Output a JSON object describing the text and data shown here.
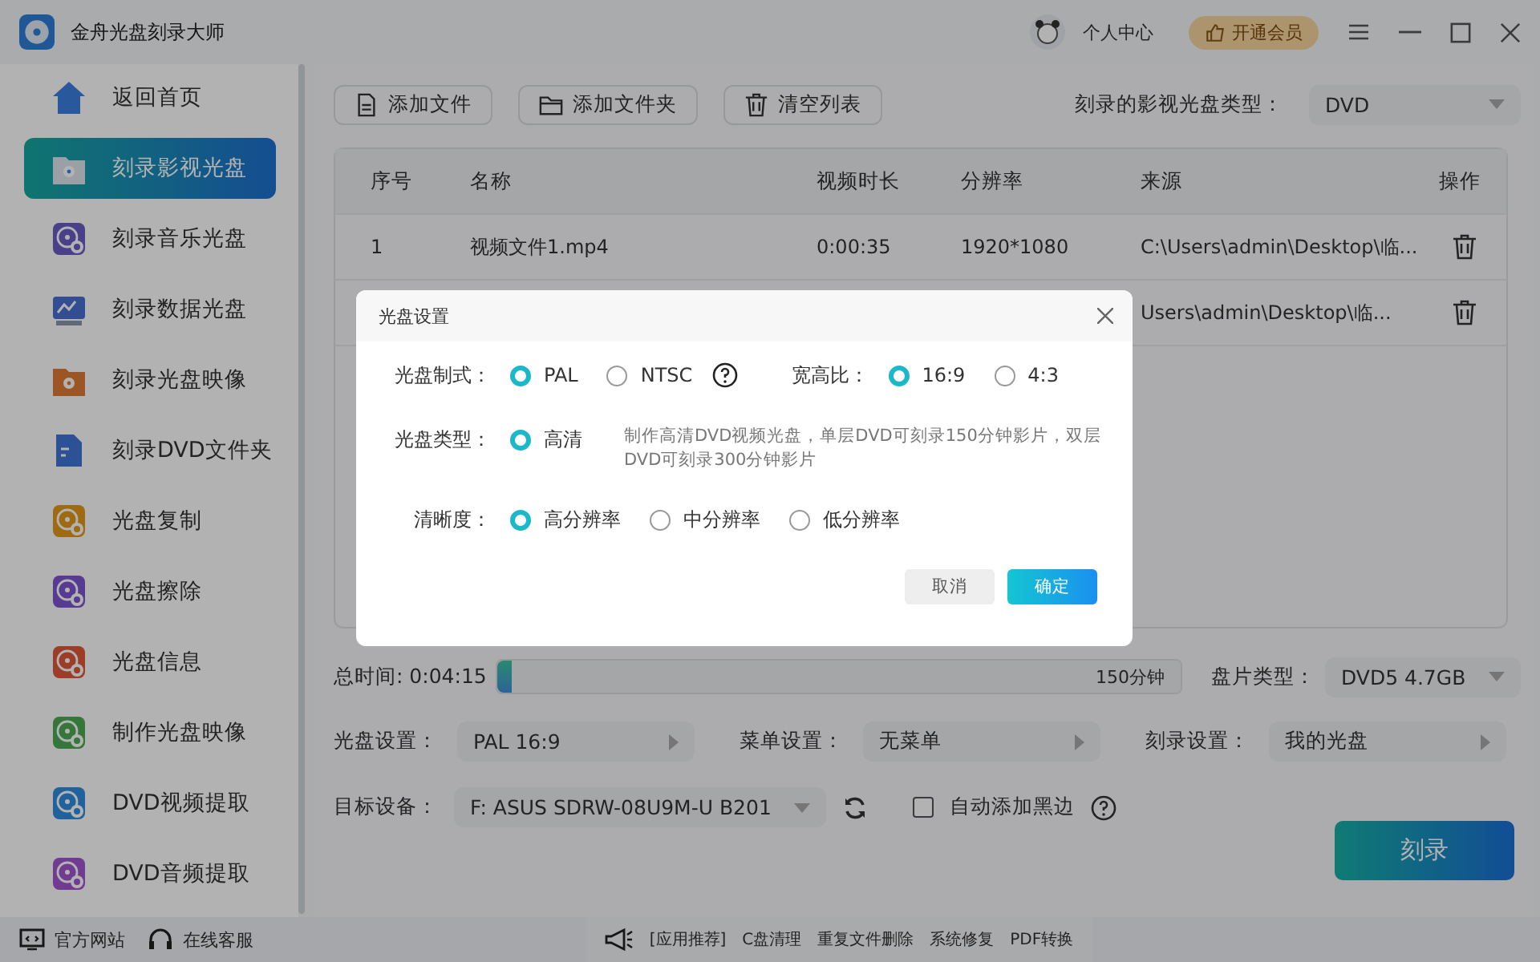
{
  "app": {
    "title": "金舟光盘刻录大师",
    "user_label": "个人中心",
    "vip_button": "开通会员"
  },
  "sidebar": {
    "items": [
      {
        "label": "返回首页",
        "kind": "home",
        "selected": false
      },
      {
        "label": "刻录影视光盘",
        "kind": "folder",
        "selected": true
      },
      {
        "label": "刻录音乐光盘",
        "kind": "disc",
        "selected": false
      },
      {
        "label": "刻录数据光盘",
        "kind": "screen",
        "selected": false
      },
      {
        "label": "刻录光盘映像",
        "kind": "folder",
        "selected": false
      },
      {
        "label": "刻录DVD文件夹",
        "kind": "doc",
        "selected": false
      },
      {
        "label": "光盘复制",
        "kind": "disc",
        "selected": false
      },
      {
        "label": "光盘擦除",
        "kind": "disc",
        "selected": false
      },
      {
        "label": "光盘信息",
        "kind": "disc",
        "selected": false
      },
      {
        "label": "制作光盘映像",
        "kind": "disc",
        "selected": false
      },
      {
        "label": "DVD视频提取",
        "kind": "disc",
        "selected": false
      },
      {
        "label": "DVD音频提取",
        "kind": "disc",
        "selected": false
      }
    ],
    "footer_links": [
      "官方网站",
      "在线客服"
    ]
  },
  "toolbar": {
    "buttons": [
      {
        "label": "添加文件",
        "kind": "file"
      },
      {
        "label": "添加文件夹",
        "kind": "folder"
      },
      {
        "label": "清空列表",
        "kind": "trash"
      }
    ],
    "disc_type_label": "刻录的影视光盘类型：",
    "disc_type_value": "DVD"
  },
  "table": {
    "columns": [
      "序号",
      "名称",
      "视频时长",
      "分辨率",
      "来源",
      "操作"
    ],
    "rows": [
      {
        "index": "1",
        "name": "视频文件1.mp4",
        "duration": "0:00:35",
        "resolution": "1920*1080",
        "source": "C:\\Users\\admin\\Desktop\\临..."
      },
      {
        "source": "Users\\admin\\Desktop\\临..."
      }
    ]
  },
  "capacity": {
    "label": "总时间: 0:04:15",
    "level": 0.02,
    "limit": "150分钟"
  },
  "disc_size": {
    "label": "盘片类型：",
    "value": "DVD5 4.7GB"
  },
  "settings": [
    {
      "label": "光盘设置：",
      "value": "PAL 16:9"
    },
    {
      "label": "菜单设置：",
      "value": "无菜单"
    },
    {
      "label": "刻录设置：",
      "value": "我的光盘"
    }
  ],
  "device": {
    "label": "目标设备：",
    "value": "F: ASUS SDRW-08U9M-U B201",
    "auto_border": {
      "label": "自动添加黑边",
      "checked": false
    }
  },
  "burn_button": "刻录",
  "promo": [
    "[应用推荐]",
    "C盘清理",
    "重复文件删除",
    "系统修复",
    "PDF转换"
  ],
  "dialog": {
    "title": "光盘设置",
    "rows": [
      {
        "groups": [
          {
            "label": "光盘制式：",
            "help": true,
            "options": [
              {
                "label": "PAL",
                "selected": true
              },
              {
                "label": "NTSC",
                "selected": false
              }
            ]
          },
          {
            "label": "宽高比：",
            "options": [
              {
                "label": "16:9",
                "selected": true
              },
              {
                "label": "4:3",
                "selected": false
              }
            ]
          }
        ]
      },
      {
        "groups": [
          {
            "label": "光盘类型：",
            "options": [
              {
                "label": "高清",
                "selected": true
              }
            ],
            "note": "制作高清DVD视频光盘，单层DVD可刻录150分钟影片，双层DVD可刻录300分钟影片"
          }
        ]
      },
      {
        "groups": [
          {
            "label": "清晰度：",
            "options": [
              {
                "label": "高分辨率",
                "selected": true
              },
              {
                "label": "中分辨率",
                "selected": false
              },
              {
                "label": "低分辨率",
                "selected": false
              }
            ]
          }
        ]
      }
    ],
    "buttons": [
      {
        "label": "取消",
        "kind": "secondary"
      },
      {
        "label": "确定",
        "kind": "primary"
      }
    ]
  }
}
